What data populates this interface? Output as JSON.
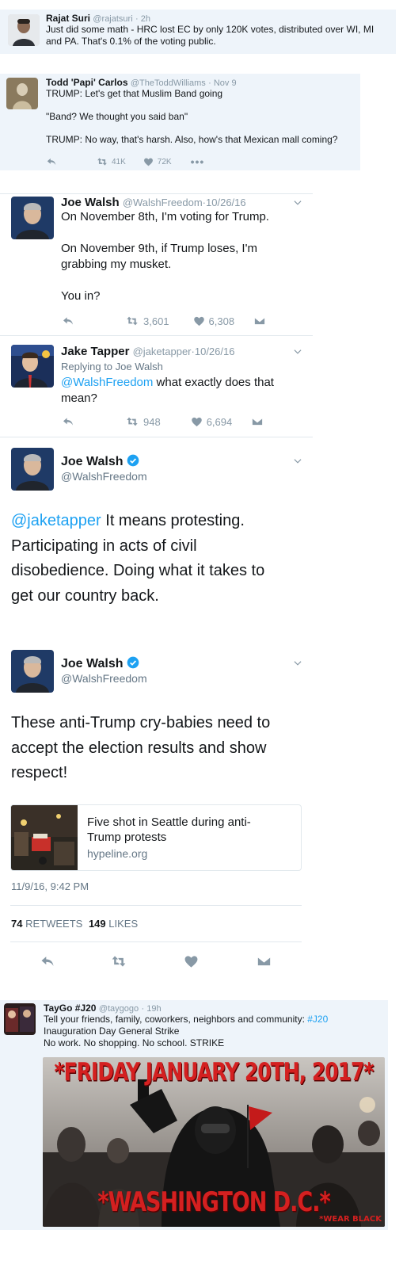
{
  "tweet1": {
    "name": "Rajat Suri",
    "handle": "@rajatsuri",
    "time": "2h",
    "text_line1": "Just did some math - HRC lost EC by only 120K votes, distributed over WI, MI",
    "text_line2": "and PA. That's 0.1% of the voting public."
  },
  "tweet2": {
    "name": "Todd 'Papi' Carlos",
    "handle": "@TheToddWilliams",
    "time": "Nov 9",
    "line1": "TRUMP: Let's get that Muslim Band going",
    "line2": "\"Band? We thought you said ban\"",
    "line3": "TRUMP: No way, that's harsh. Also, how's that Mexican mall coming?",
    "retweets": "41K",
    "likes": "72K"
  },
  "tweet3": {
    "name": "Joe Walsh",
    "handle": "@WalshFreedom",
    "time": "10/26/16",
    "line1": "On November 8th, I'm voting for Trump.",
    "line2": "On November 9th, if Trump loses, I'm",
    "line3": "grabbing my musket.",
    "line4": "You in?",
    "retweets": "3,601",
    "likes": "6,308"
  },
  "tweet4": {
    "name": "Jake Tapper",
    "handle": "@jaketapper",
    "time": "10/26/16",
    "replying": "Replying to Joe Walsh",
    "mention": "@WalshFreedom",
    "text1": "what exactly does that",
    "text2": "mean?",
    "retweets": "948",
    "likes": "6,694"
  },
  "tweet5": {
    "name": "Joe Walsh",
    "handle": "@WalshFreedom",
    "mention": "@jaketapper",
    "line1": "It means protesting.",
    "line2": "Participating in acts of civil",
    "line3": "disobedience. Doing what it takes to",
    "line4": "get our country back."
  },
  "tweet6": {
    "name": "Joe Walsh",
    "handle": "@WalshFreedom",
    "line1": "These anti-Trump cry-babies need to",
    "line2": "accept the election results and show",
    "line3": "respect!",
    "card_title1": "Five shot in Seattle during anti-",
    "card_title2": "Trump protests",
    "card_domain": "hypeline.org",
    "timestamp": "11/9/16, 9:42 PM",
    "retweets_count": "74",
    "retweets_label": "RETWEETS",
    "likes_count": "149",
    "likes_label": "LIKES"
  },
  "tweet7": {
    "name": "TayGo #J20",
    "handle": "@taygogo",
    "time": "19h",
    "line1": "Tell your friends, family, coworkers, neighbors and community:",
    "hashtag": "#J20",
    "line2": "Inauguration Day General Strike",
    "line3": "No work. No shopping. No school. STRIKE",
    "poster_top": "*FRIDAY JANUARY 20TH, 2017*",
    "poster_bottom": "*WASHINGTON D.C.*",
    "poster_note": "*WEAR BLACK"
  },
  "colors": {
    "link": "#1da1f2",
    "gray": "#8899a6",
    "verified": "#1da1f2",
    "poster_red": "#d42020"
  },
  "icons": [
    "reply-icon",
    "retweet-icon",
    "like-icon",
    "more-icon",
    "message-icon",
    "chevron-down-icon",
    "verified-icon"
  ]
}
